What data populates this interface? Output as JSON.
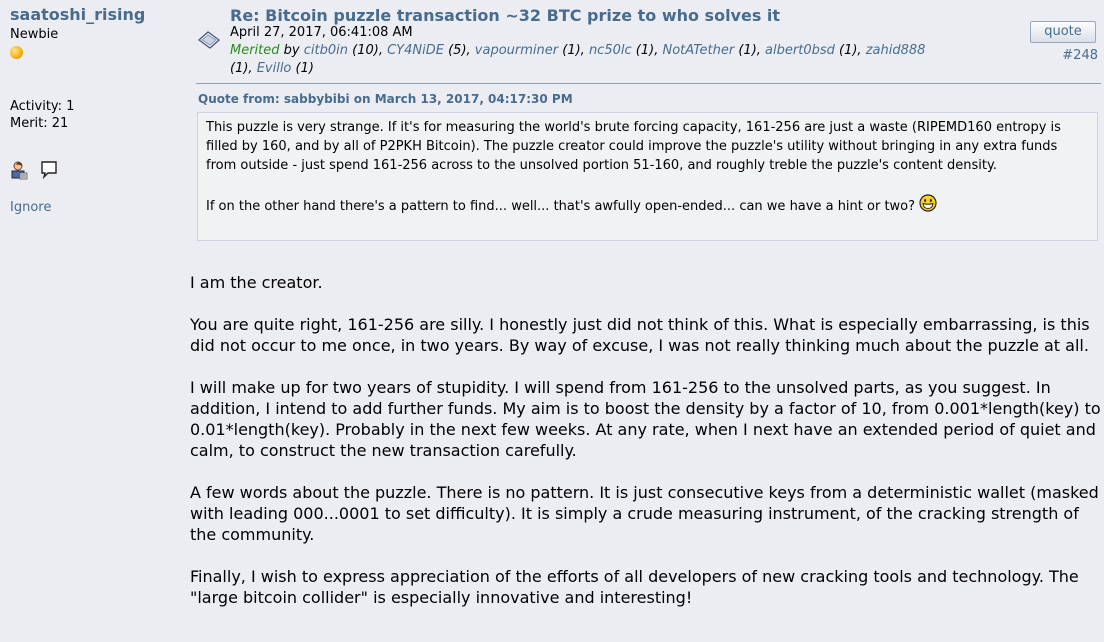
{
  "poster": {
    "name": "saatoshi_rising",
    "rank": "Newbie",
    "activity": "Activity: 1",
    "merit": "Merit: 21",
    "ignore": "Ignore"
  },
  "post": {
    "subject": "Re: Bitcoin puzzle transaction ~32 BTC prize to who solves it",
    "date": "April 27, 2017, 06:41:08 AM",
    "merited_label": "Merited",
    "merited_by": "by",
    "merits": [
      {
        "name": "citb0in",
        "count": "(10),"
      },
      {
        "name": "CY4NiDE",
        "count": "(5),"
      },
      {
        "name": "vapourminer",
        "count": "(1),"
      },
      {
        "name": "nc50lc",
        "count": "(1),"
      },
      {
        "name": "NotATether",
        "count": "(1),"
      },
      {
        "name": "albert0bsd",
        "count": "(1),"
      },
      {
        "name": "zahid888",
        "count": "(1),"
      },
      {
        "name": "Evillo",
        "count": "(1)"
      }
    ],
    "quote_button": "quote",
    "number": "#248"
  },
  "quote": {
    "header": "Quote from: sabbybibi on March 13, 2017, 04:17:30 PM",
    "p1": "This puzzle is very strange. If it's for measuring the world's brute forcing capacity, 161-256 are just a waste (RIPEMD160 entropy is filled by 160, and by all of P2PKH Bitcoin). The puzzle creator could improve the puzzle's utility without bringing in any extra funds from outside - just spend 161-256 across to the unsolved portion 51-160, and roughly treble the puzzle's content density.",
    "p2": "If on the other hand there's a pattern to find... well... that's awfully open-ended... can we have a hint or two?"
  },
  "body": {
    "p1": "I am the creator.",
    "p2": "You are quite right, 161-256 are silly.  I honestly just did not think of this.  What is especially embarrassing, is this did not occur to me once, in two years.  By way of excuse, I was not really thinking much about the puzzle at all.",
    "p3": "I will make up for two years of stupidity.  I will spend from 161-256 to the unsolved parts, as you suggest.  In addition, I intend to add further funds.  My aim is to boost the density by a factor of 10, from 0.001*length(key) to 0.01*length(key).  Probably in the next few weeks.  At any rate, when I next have an extended period of quiet and calm, to construct the new transaction carefully.",
    "p4": "A few words about the puzzle.  There is no pattern.  It is just consecutive keys from a deterministic wallet (masked with leading 000...0001 to set difficulty).  It is simply a crude measuring instrument, of the cracking strength of the community.",
    "p5": "Finally, I wish to express appreciation of the efforts of all developers of new cracking tools and technology.  The \"large bitcoin collider\" is especially innovative and interesting!"
  },
  "colors": {
    "link": "#476c8e",
    "merited": "#2a8a1e",
    "background": "#ecedf3",
    "quote_bg": "#f1f2f4"
  },
  "icons": [
    "coin-icon",
    "profile-icon",
    "message-icon",
    "post-icon",
    "grin-smiley-icon"
  ]
}
